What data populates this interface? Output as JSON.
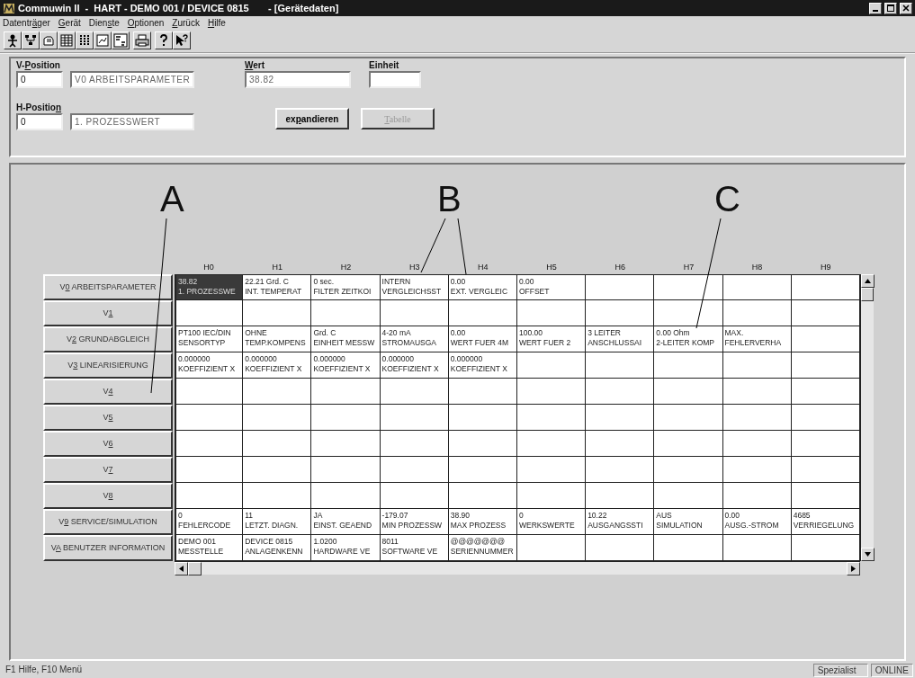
{
  "window": {
    "title": "Commuwin II  -  HART - DEMO 001 / DEVICE 0815       - [Gerätedaten]"
  },
  "menu": [
    {
      "label": "Datenträger"
    },
    {
      "label": "Gerät"
    },
    {
      "label": "Dienste"
    },
    {
      "label": "Optionen"
    },
    {
      "label": "Zurück"
    },
    {
      "label": "Hilfe"
    }
  ],
  "form": {
    "v_position": {
      "label": "V-Position",
      "value": "0",
      "name": "V0 ARBEITSPARAMETER"
    },
    "wert": {
      "label": "Wert",
      "value": "38.82"
    },
    "einheit": {
      "label": "Einheit"
    },
    "h_position": {
      "label": "H-Position",
      "value": "0",
      "name": "1. PROZESSWERT"
    },
    "buttons": [
      {
        "label": "expandieren",
        "disabled": false
      },
      {
        "label": "Tabelle",
        "disabled": true
      }
    ]
  },
  "callouts": [
    {
      "label": "A"
    },
    {
      "label": "B"
    },
    {
      "label": "C"
    }
  ],
  "table": {
    "columns": [
      "H0",
      "H1",
      "H2",
      "H3",
      "H4",
      "H5",
      "H6",
      "H7",
      "H8",
      "H9"
    ],
    "rows": [
      {
        "label": "V0 ARBEITSPARAMETER",
        "cells": [
          {
            "value": "38.82",
            "name": "1. PROZESSWE",
            "selected": true
          },
          {
            "value": "22.21  Grd. C",
            "name": "INT. TEMPERAT",
            "selected": false
          },
          {
            "value": "0  sec.",
            "name": "FILTER ZEITKOI",
            "selected": false
          },
          {
            "value": "INTERN",
            "name": "VERGLEICHSST",
            "selected": false
          },
          {
            "value": "0.00",
            "name": "EXT. VERGLEIC",
            "selected": false
          },
          {
            "value": "0.00",
            "name": "OFFSET",
            "selected": false
          },
          {
            "selected": false
          },
          {
            "selected": false
          },
          {
            "selected": false
          },
          {
            "selected": false
          }
        ]
      },
      {
        "label": "V1",
        "cells": [
          {
            "selected": false
          },
          {
            "selected": false
          },
          {
            "selected": false
          },
          {
            "selected": false
          },
          {
            "selected": false
          },
          {
            "selected": false
          },
          {
            "selected": false
          },
          {
            "selected": false
          },
          {
            "selected": false
          },
          {
            "selected": false
          }
        ]
      },
      {
        "label": "V2 GRUNDABGLEICH",
        "cells": [
          {
            "value": "PT100 IEC/DIN",
            "name": "SENSORTYP",
            "selected": false
          },
          {
            "value": "OHNE",
            "name": "TEMP.KOMPENS",
            "selected": false
          },
          {
            "value": "Grd. C",
            "name": "EINHEIT MESSW",
            "selected": false
          },
          {
            "value": "4-20 mA",
            "name": "STROMAUSGA",
            "selected": false
          },
          {
            "value": "0.00",
            "name": "WERT FUER 4M",
            "selected": false
          },
          {
            "value": "100.00",
            "name": "WERT FUER  2",
            "selected": false
          },
          {
            "value": "3 LEITER",
            "name": "ANSCHLUSSAI",
            "selected": false
          },
          {
            "value": "0.00  Ohm",
            "name": "2-LEITER KOMP",
            "selected": false
          },
          {
            "value": "MAX.",
            "name": "FEHLERVERHA",
            "selected": false
          },
          {
            "selected": false
          }
        ]
      },
      {
        "label": "V3 LINEARISIERUNG",
        "cells": [
          {
            "value": "0.000000",
            "name": "KOEFFIZIENT X",
            "selected": false
          },
          {
            "value": "0.000000",
            "name": "KOEFFIZIENT X",
            "selected": false
          },
          {
            "value": "0.000000",
            "name": "KOEFFIZIENT X",
            "selected": false
          },
          {
            "value": "0.000000",
            "name": "KOEFFIZIENT X",
            "selected": false
          },
          {
            "value": "0.000000",
            "name": "KOEFFIZIENT X",
            "selected": false
          },
          {
            "selected": false
          },
          {
            "selected": false
          },
          {
            "selected": false
          },
          {
            "selected": false
          },
          {
            "selected": false
          }
        ]
      },
      {
        "label": "V4",
        "cells": [
          {
            "selected": false
          },
          {
            "selected": false
          },
          {
            "selected": false
          },
          {
            "selected": false
          },
          {
            "selected": false
          },
          {
            "selected": false
          },
          {
            "selected": false
          },
          {
            "selected": false
          },
          {
            "selected": false
          },
          {
            "selected": false
          }
        ]
      },
      {
        "label": "V5",
        "cells": [
          {
            "selected": false
          },
          {
            "selected": false
          },
          {
            "selected": false
          },
          {
            "selected": false
          },
          {
            "selected": false
          },
          {
            "selected": false
          },
          {
            "selected": false
          },
          {
            "selected": false
          },
          {
            "selected": false
          },
          {
            "selected": false
          }
        ]
      },
      {
        "label": "V6",
        "cells": [
          {
            "selected": false
          },
          {
            "selected": false
          },
          {
            "selected": false
          },
          {
            "selected": false
          },
          {
            "selected": false
          },
          {
            "selected": false
          },
          {
            "selected": false
          },
          {
            "selected": false
          },
          {
            "selected": false
          },
          {
            "selected": false
          }
        ]
      },
      {
        "label": "V7",
        "cells": [
          {
            "selected": false
          },
          {
            "selected": false
          },
          {
            "selected": false
          },
          {
            "selected": false
          },
          {
            "selected": false
          },
          {
            "selected": false
          },
          {
            "selected": false
          },
          {
            "selected": false
          },
          {
            "selected": false
          },
          {
            "selected": false
          }
        ]
      },
      {
        "label": "V8",
        "cells": [
          {
            "selected": false
          },
          {
            "selected": false
          },
          {
            "selected": false
          },
          {
            "selected": false
          },
          {
            "selected": false
          },
          {
            "selected": false
          },
          {
            "selected": false
          },
          {
            "selected": false
          },
          {
            "selected": false
          },
          {
            "selected": false
          }
        ]
      },
      {
        "label": "V9 SERVICE/SIMULATION",
        "cells": [
          {
            "value": "0",
            "name": "FEHLERCODE",
            "selected": false
          },
          {
            "value": "11",
            "name": "LETZT. DIAGN.",
            "selected": false
          },
          {
            "value": "JA",
            "name": "EINST. GEAEND",
            "selected": false
          },
          {
            "value": "-179.07",
            "name": "MIN PROZESSW",
            "selected": false
          },
          {
            "value": "38.90",
            "name": "MAX PROZESS",
            "selected": false
          },
          {
            "value": "0",
            "name": "WERKSWERTE",
            "selected": false
          },
          {
            "value": "10.22",
            "name": "AUSGANGSSTI",
            "selected": false
          },
          {
            "value": "AUS",
            "name": "SIMULATION",
            "selected": false
          },
          {
            "value": "0.00",
            "name": "AUSG.-STROM",
            "selected": false
          },
          {
            "value": "4685",
            "name": "VERRIEGELUNG",
            "selected": false
          }
        ]
      },
      {
        "label": "VA BENUTZER INFORMATION",
        "cells": [
          {
            "value": "DEMO 001",
            "name": "MESSTELLE",
            "selected": false
          },
          {
            "value": "DEVICE 0815",
            "name": "ANLAGENKENN",
            "selected": false
          },
          {
            "value": "1.0200",
            "name": "HARDWARE VE",
            "selected": false
          },
          {
            "value": "8011",
            "name": "SOFTWARE VE",
            "selected": false
          },
          {
            "value": "@@@@@@@",
            "name": "SERIENNUMMER",
            "selected": false
          },
          {
            "selected": false
          },
          {
            "selected": false
          },
          {
            "selected": false
          },
          {
            "selected": false
          },
          {
            "selected": false
          }
        ]
      }
    ]
  },
  "status_bar": {
    "help": "F1 Hilfe, F10 Menü",
    "user": "Spezialist",
    "connection": "ONLINE"
  }
}
